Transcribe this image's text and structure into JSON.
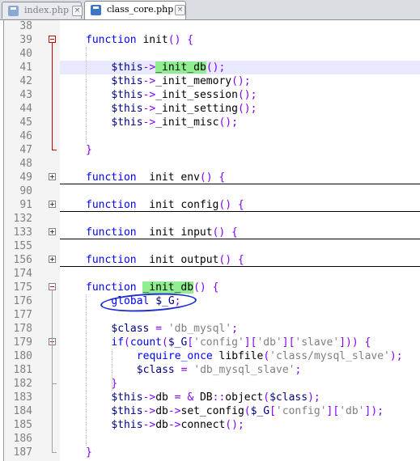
{
  "tabs": [
    {
      "label": "index.php",
      "active": false,
      "icon": "php-file-icon"
    },
    {
      "label": "class_core.php",
      "active": true,
      "icon": "php-file-icon"
    }
  ],
  "colors": {
    "keyword": "#0000ff",
    "variable": "#000080",
    "operator": "#8000ff",
    "string": "#808080",
    "highlight": "#90ee90",
    "current_line": "#e8e8ff",
    "annotation": "#1f2fcf"
  },
  "lines": [
    {
      "n": "38",
      "tokens": []
    },
    {
      "n": "39",
      "fold": "open",
      "tokens": [
        [
          "kw",
          "function"
        ],
        [
          "plain",
          " init"
        ],
        [
          "op",
          "()"
        ],
        [
          "plain",
          " "
        ],
        [
          "op",
          "{"
        ]
      ]
    },
    {
      "n": "40",
      "tokens": []
    },
    {
      "n": "41",
      "current": true,
      "tokens": [
        [
          "var",
          "$this"
        ],
        [
          "op",
          "->"
        ],
        [
          "hl",
          "_init_db"
        ],
        [
          "op",
          "();"
        ]
      ]
    },
    {
      "n": "42",
      "tokens": [
        [
          "var",
          "$this"
        ],
        [
          "op",
          "->"
        ],
        [
          "plain",
          "_init_memory"
        ],
        [
          "op",
          "();"
        ]
      ]
    },
    {
      "n": "43",
      "tokens": [
        [
          "var",
          "$this"
        ],
        [
          "op",
          "->"
        ],
        [
          "plain",
          "_init_session"
        ],
        [
          "op",
          "();"
        ]
      ]
    },
    {
      "n": "44",
      "tokens": [
        [
          "var",
          "$this"
        ],
        [
          "op",
          "->"
        ],
        [
          "plain",
          "_init_setting"
        ],
        [
          "op",
          "();"
        ]
      ]
    },
    {
      "n": "45",
      "tokens": [
        [
          "var",
          "$this"
        ],
        [
          "op",
          "->"
        ],
        [
          "plain",
          "_init_misc"
        ],
        [
          "op",
          "();"
        ]
      ]
    },
    {
      "n": "46",
      "tokens": []
    },
    {
      "n": "47",
      "tokens": [
        [
          "op",
          "}"
        ]
      ]
    },
    {
      "n": "48",
      "tokens": []
    },
    {
      "n": "49",
      "fold": "closed",
      "tokens": [
        [
          "kw",
          "function"
        ],
        [
          "plain",
          "  init env"
        ],
        [
          "op",
          "()"
        ],
        [
          "plain",
          " "
        ],
        [
          "op",
          "{"
        ]
      ]
    },
    {
      "n": "90",
      "tokens": []
    },
    {
      "n": "91",
      "fold": "closed",
      "tokens": [
        [
          "kw",
          "function"
        ],
        [
          "plain",
          "  init config"
        ],
        [
          "op",
          "()"
        ],
        [
          "plain",
          " "
        ],
        [
          "op",
          "{"
        ]
      ]
    },
    {
      "n": "132",
      "tokens": []
    },
    {
      "n": "133",
      "fold": "closed",
      "tokens": [
        [
          "kw",
          "function"
        ],
        [
          "plain",
          "  init input"
        ],
        [
          "op",
          "()"
        ],
        [
          "plain",
          " "
        ],
        [
          "op",
          "{"
        ]
      ]
    },
    {
      "n": "155",
      "tokens": []
    },
    {
      "n": "156",
      "fold": "closed",
      "tokens": [
        [
          "kw",
          "function"
        ],
        [
          "plain",
          "  init output"
        ],
        [
          "op",
          "()"
        ],
        [
          "plain",
          " "
        ],
        [
          "op",
          "{"
        ]
      ]
    },
    {
      "n": "174",
      "tokens": []
    },
    {
      "n": "175",
      "fold": "open-gray",
      "tokens": [
        [
          "kw",
          "function"
        ],
        [
          "plain",
          " "
        ],
        [
          "hl",
          "_init_db"
        ],
        [
          "op",
          "()"
        ],
        [
          "plain",
          " "
        ],
        [
          "op",
          "{"
        ]
      ]
    },
    {
      "n": "176",
      "tokens": [
        [
          "kw",
          "global"
        ],
        [
          "plain",
          " "
        ],
        [
          "var",
          "$_G"
        ],
        [
          "op",
          ";"
        ]
      ]
    },
    {
      "n": "177",
      "tokens": []
    },
    {
      "n": "178",
      "tokens": [
        [
          "var",
          "$class"
        ],
        [
          "plain",
          " "
        ],
        [
          "op",
          "="
        ],
        [
          "plain",
          " "
        ],
        [
          "str",
          "'db_mysql'"
        ],
        [
          "op",
          ";"
        ]
      ]
    },
    {
      "n": "179",
      "fold": "open-gray",
      "tokens": [
        [
          "kw",
          "if"
        ],
        [
          "op",
          "("
        ],
        [
          "kw",
          "count"
        ],
        [
          "op",
          "("
        ],
        [
          "var",
          "$_G"
        ],
        [
          "op",
          "["
        ],
        [
          "str",
          "'config'"
        ],
        [
          "op",
          "]["
        ],
        [
          "str",
          "'db'"
        ],
        [
          "op",
          "]["
        ],
        [
          "str",
          "'slave'"
        ],
        [
          "op",
          "]))"
        ],
        [
          "plain",
          " "
        ],
        [
          "op",
          "{"
        ]
      ]
    },
    {
      "n": "180",
      "tokens": [
        [
          "kw",
          "require_once"
        ],
        [
          "plain",
          " libfile"
        ],
        [
          "op",
          "("
        ],
        [
          "str",
          "'class/mysql_slave'"
        ],
        [
          "op",
          ");"
        ]
      ]
    },
    {
      "n": "181",
      "tokens": [
        [
          "var",
          "$class"
        ],
        [
          "plain",
          " "
        ],
        [
          "op",
          "="
        ],
        [
          "plain",
          " "
        ],
        [
          "str",
          "'db_mysql_slave'"
        ],
        [
          "op",
          ";"
        ]
      ]
    },
    {
      "n": "182",
      "tokens": [
        [
          "op",
          "}"
        ]
      ]
    },
    {
      "n": "183",
      "tokens": [
        [
          "var",
          "$this"
        ],
        [
          "op",
          "->"
        ],
        [
          "plain",
          "db "
        ],
        [
          "op",
          "="
        ],
        [
          "plain",
          " "
        ],
        [
          "op",
          "&"
        ],
        [
          "plain",
          " DB"
        ],
        [
          "op",
          "::"
        ],
        [
          "plain",
          "object"
        ],
        [
          "op",
          "("
        ],
        [
          "var",
          "$class"
        ],
        [
          "op",
          ");"
        ]
      ]
    },
    {
      "n": "184",
      "tokens": [
        [
          "var",
          "$this"
        ],
        [
          "op",
          "->"
        ],
        [
          "plain",
          "db"
        ],
        [
          "op",
          "->"
        ],
        [
          "plain",
          "set_config"
        ],
        [
          "op",
          "("
        ],
        [
          "var",
          "$_G"
        ],
        [
          "op",
          "["
        ],
        [
          "str",
          "'config'"
        ],
        [
          "op",
          "]["
        ],
        [
          "str",
          "'db'"
        ],
        [
          "op",
          "]);"
        ]
      ]
    },
    {
      "n": "185",
      "tokens": [
        [
          "var",
          "$this"
        ],
        [
          "op",
          "->"
        ],
        [
          "plain",
          "db"
        ],
        [
          "op",
          "->"
        ],
        [
          "plain",
          "connect"
        ],
        [
          "op",
          "();"
        ]
      ]
    },
    {
      "n": "186",
      "tokens": []
    },
    {
      "n": "187",
      "tokens": [
        [
          "op",
          "}"
        ]
      ]
    }
  ]
}
